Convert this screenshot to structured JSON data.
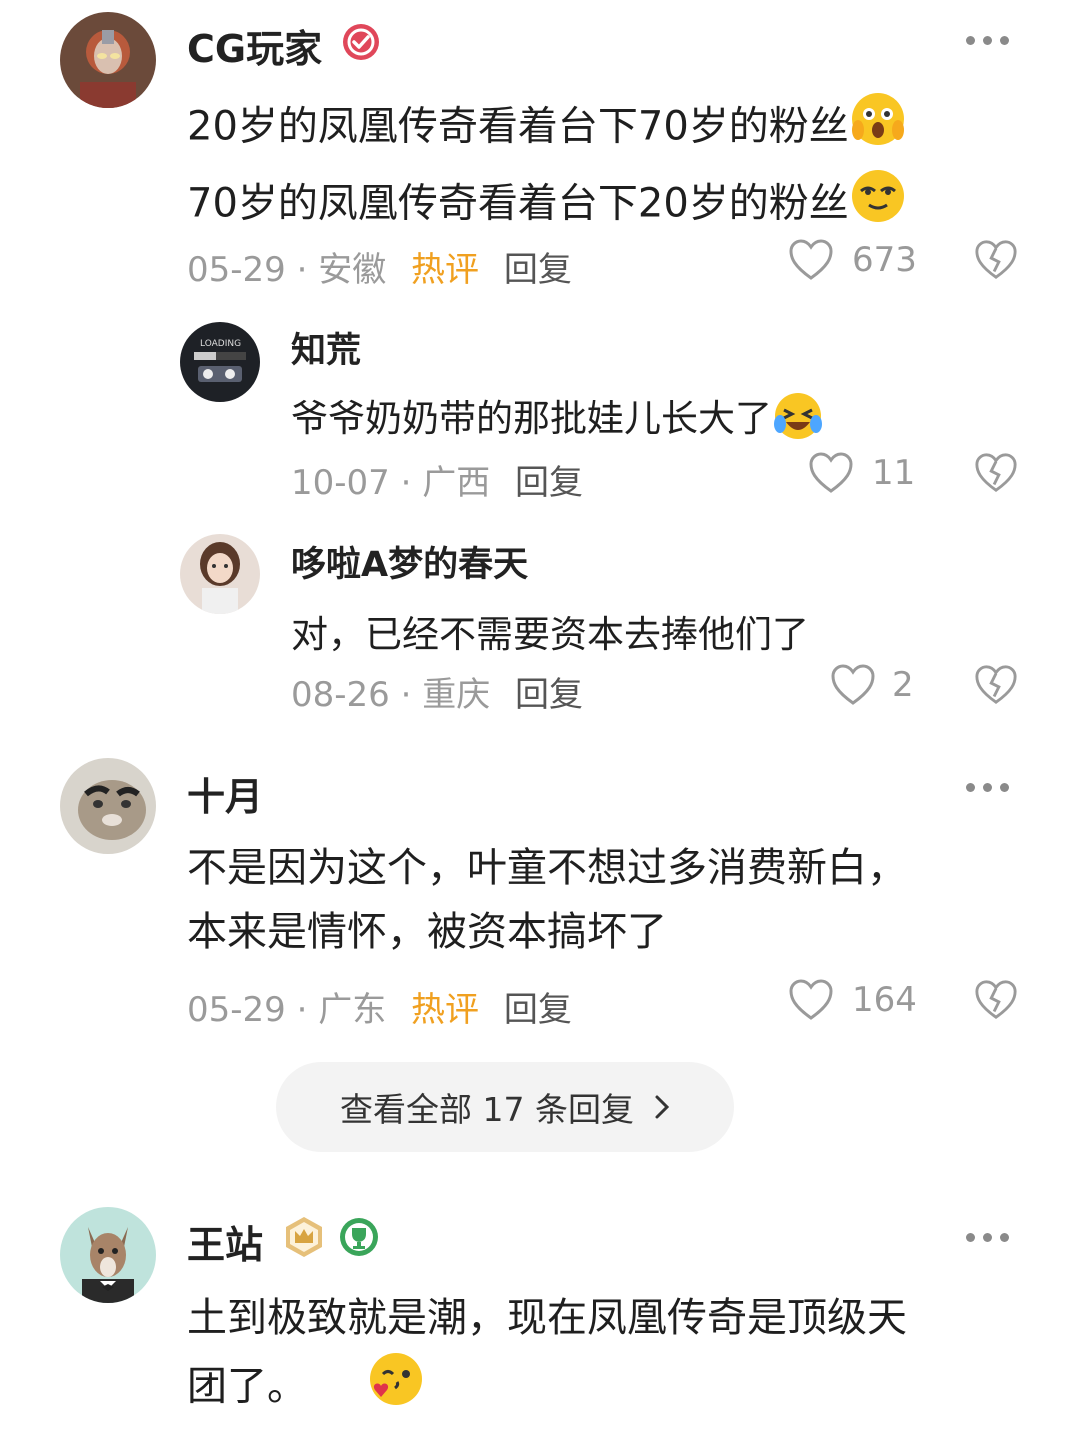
{
  "comments": [
    {
      "user": "CG玩家",
      "badge_icon": "verified-check-icon",
      "lines": [
        "20岁的凤凰传奇看着台下70岁的粉丝",
        "70岁的凤凰传奇看着台下20岁的粉丝"
      ],
      "line_emojis": [
        "astonished-emoji",
        "smirk-emoji"
      ],
      "date": "05-29",
      "location": "安徽",
      "hot_label": "热评",
      "reply_label": "回复",
      "likes": "673",
      "replies": [
        {
          "user": "知荒",
          "text": "爷爷奶奶带的那批娃儿长大了",
          "emoji": "laughing-crying-emoji",
          "date": "10-07",
          "location": "广西",
          "reply_label": "回复",
          "likes": "11"
        },
        {
          "user": "哆啦A梦的春天",
          "text": "对，已经不需要资本去捧他们了",
          "date": "08-26",
          "location": "重庆",
          "reply_label": "回复",
          "likes": "2"
        }
      ]
    },
    {
      "user": "十月",
      "lines": [
        "不是因为这个，叶童不想过多消费新白，",
        "本来是情怀，被资本搞坏了"
      ],
      "date": "05-29",
      "location": "广东",
      "hot_label": "热评",
      "reply_label": "回复",
      "likes": "164",
      "view_all_label": "查看全部 17 条回复"
    },
    {
      "user": "王站",
      "badge_icons": [
        "crown-badge-icon",
        "trophy-badge-icon"
      ],
      "lines": [
        "土到极致就是潮，现在凤凰传奇是顶级天",
        "团了。"
      ],
      "end_emoji": "wink-kiss-emoji"
    }
  ],
  "sep": "·",
  "colors": {
    "hot": "#f0a020",
    "meta": "#9a9a9a",
    "pill_bg": "#f3f3f3"
  }
}
